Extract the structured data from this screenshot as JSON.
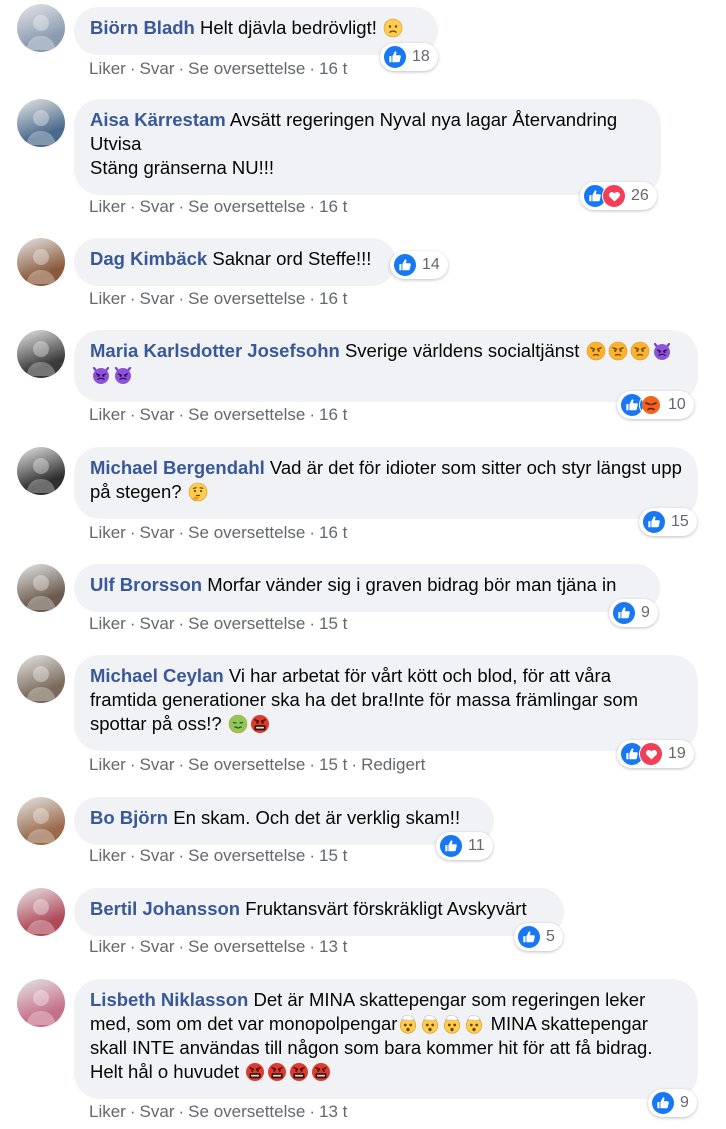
{
  "actions": {
    "like": "Liker",
    "reply": "Svar",
    "translate": "Se oversettelse",
    "edited": "Redigert"
  },
  "comments": [
    {
      "author": "Biörn Bladh",
      "text": "Helt djävla bedrövligt!",
      "emojis_after": [
        "sad-face"
      ],
      "time": "16 t",
      "reactions": [
        "like"
      ],
      "count": "18",
      "avatar_color": "#8a9bb0"
    },
    {
      "author": "Aisa Kärrestam",
      "text": "Avsätt regeringen Nyval nya lagar Återvandring\nUtvisa\nStäng gränserna NU!!!",
      "emojis_after": [],
      "time": "16 t",
      "reactions": [
        "like",
        "love"
      ],
      "count": "26",
      "avatar_color": "#4a6a8c"
    },
    {
      "author": "Dag Kimbäck",
      "text": "Saknar ord Steffe!!!",
      "emojis_after": [],
      "time": "16 t",
      "reactions": [
        "like"
      ],
      "count": "14",
      "avatar_color": "#8b5a3c"
    },
    {
      "author": "Maria Karlsdotter Josefsohn",
      "text": "Sverige världens socialtjänst",
      "emojis_after": [
        "angry-face",
        "angry-face",
        "angry-face",
        "devil-face",
        "devil-face",
        "devil-face"
      ],
      "time": "16 t",
      "reactions": [
        "like",
        "angry"
      ],
      "count": "10",
      "avatar_color": "#3a3a3a"
    },
    {
      "author": "Michael Bergendahl",
      "text": "Vad är det för idioter som sitter och styr längst upp på stegen?",
      "emojis_after": [
        "thinking-face"
      ],
      "time": "16 t",
      "reactions": [
        "like"
      ],
      "count": "15",
      "avatar_color": "#2e2e2e"
    },
    {
      "author": "Ulf Brorsson",
      "text": "Morfar vänder sig i graven bidrag bör man tjäna in",
      "emojis_after": [],
      "time": "15 t",
      "reactions": [
        "like"
      ],
      "count": "9",
      "avatar_color": "#6b5b4e"
    },
    {
      "author": "Michael Ceylan",
      "text": "Vi har arbetat för vårt kött och blod, för att våra framtida generationer ska ha det bra!Inte för massa främlingar som spottar på oss!?",
      "emojis_after": [
        "nauseated-face",
        "cursing-face"
      ],
      "time": "15 t",
      "edited": true,
      "reactions": [
        "like",
        "love"
      ],
      "count": "19",
      "avatar_color": "#7a6a5a"
    },
    {
      "author": "Bo Björn",
      "text": "En skam. Och det är verklig skam!!",
      "emojis_after": [],
      "time": "15 t",
      "reactions": [
        "like"
      ],
      "count": "11",
      "avatar_color": "#9a6b4b"
    },
    {
      "author": "Bertil Johansson",
      "text": "Fruktansvärt förskräkligt Avskyvärt",
      "emojis_after": [],
      "time": "13 t",
      "reactions": [
        "like"
      ],
      "count": "5",
      "avatar_color": "#b04a5a"
    },
    {
      "author": "Lisbeth Niklasson",
      "text": "Det är MINA skattepengar som regeringen leker med, som om det var monopolpengar",
      "emojis_mid": [
        "exploding-head",
        "exploding-head",
        "exploding-head",
        "exploding-head"
      ],
      "text2": "MINA skattepengar skall INTE användas till någon som bara kommer hit för att få bidrag. Helt hål o huvudet",
      "emojis_after": [
        "cursing-face",
        "cursing-face",
        "cursing-face",
        "cursing-face"
      ],
      "time": "13 t",
      "reactions": [
        "like"
      ],
      "count": "9",
      "avatar_color": "#c4708a"
    }
  ]
}
